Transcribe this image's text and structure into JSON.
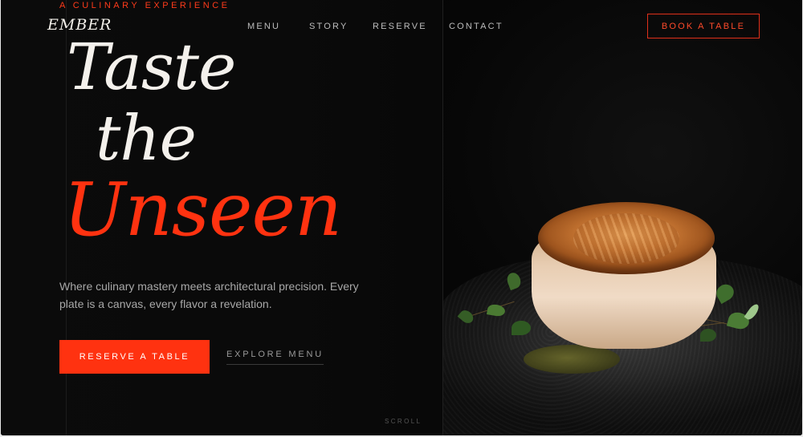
{
  "header": {
    "eyebrow": "A CULINARY EXPERIENCE",
    "logo": "EMBER",
    "nav": [
      "MENU",
      "STORY",
      "RESERVE",
      "CONTACT"
    ],
    "cta": "BOOK A TABLE"
  },
  "hero": {
    "line1": "Taste",
    "line2": "the",
    "line3": "Unseen",
    "lede": "Where culinary mastery meets architectural precision. Every plate is a canvas, every flavor a revelation.",
    "primary_cta": "RESERVE A TABLE",
    "secondary_cta": "EXPLORE MENU",
    "scroll": "SCROLL",
    "image_subject": "seared-scallop-on-slate"
  },
  "colors": {
    "accent": "#ff3210",
    "background": "#090909",
    "text": "#f4f1ec"
  }
}
